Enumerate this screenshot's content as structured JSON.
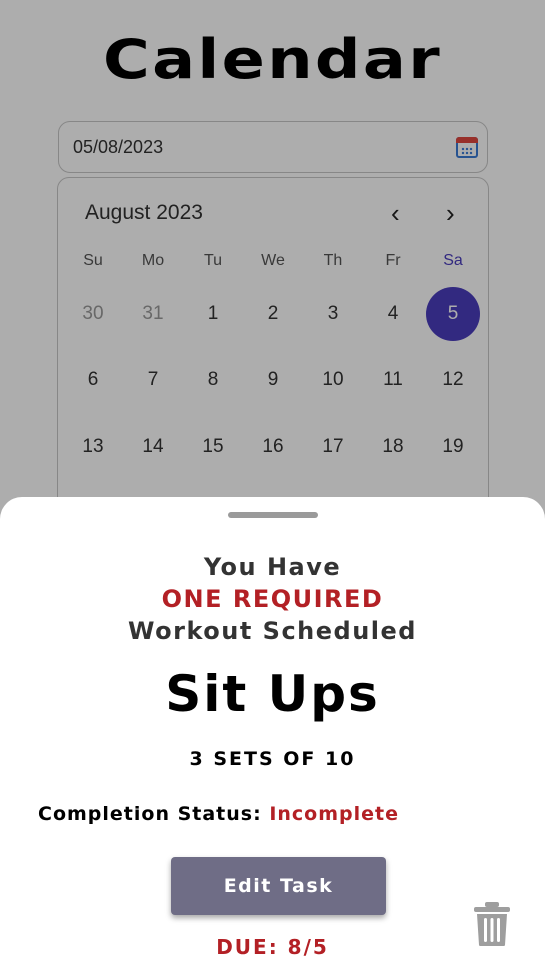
{
  "page": {
    "title": "Calendar"
  },
  "date_input": {
    "value": "05/08/2023",
    "icon": "calendar-icon"
  },
  "calendar": {
    "month_label": "August 2023",
    "prev_icon": "chevron-left-icon",
    "next_icon": "chevron-right-icon",
    "weekdays": [
      "Su",
      "Mo",
      "Tu",
      "We",
      "Th",
      "Fr",
      "Sa"
    ],
    "weeks": [
      [
        "30",
        "31",
        "1",
        "2",
        "3",
        "4",
        "5"
      ],
      [
        "6",
        "7",
        "8",
        "9",
        "10",
        "11",
        "12"
      ],
      [
        "13",
        "14",
        "15",
        "16",
        "17",
        "18",
        "19"
      ]
    ],
    "selected_day": "5",
    "accent_color": "#4a3dbd"
  },
  "sheet": {
    "line1": "You Have",
    "line2": "ONE REQUIRED",
    "line3": "Workout Scheduled",
    "workout_name": "Sit Ups",
    "sets": "3 SETS OF 10",
    "status_label": "Completion Status:",
    "status_value": "Incomplete",
    "edit_button": "Edit Task",
    "due": "DUE: 8/5",
    "delete_icon": "trash-icon",
    "alert_color": "#b32025",
    "button_color": "#6f6d86"
  }
}
